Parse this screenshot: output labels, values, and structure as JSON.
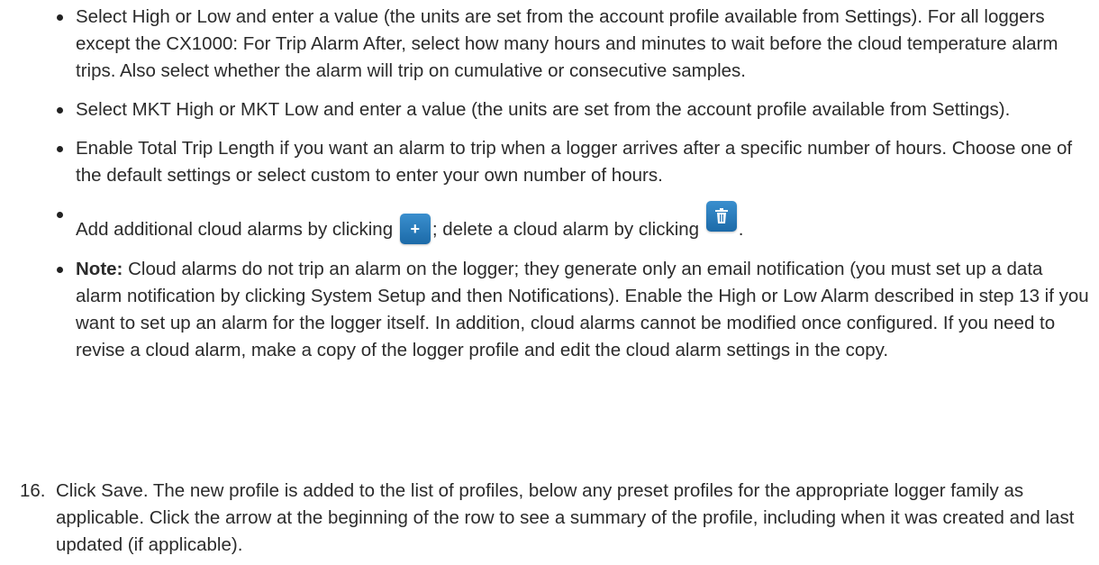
{
  "bullets": [
    "Select High or Low and enter a value (the units are set from the account profile available from Settings). For all loggers except the CX1000: For Trip Alarm After, select how many hours and minutes to wait before the cloud temperature alarm trips. Also select whether the alarm will trip on cumulative or consecutive samples.",
    "Select MKT High or MKT Low and enter a value (the units are set from the account profile available from Settings).",
    "Enable Total Trip Length if you want an alarm to trip when a logger arrives after a specific number of hours. Choose one of the default settings or select custom to enter your own number of hours."
  ],
  "alarm_buttons_line": {
    "part1": "Add additional cloud alarms by clicking",
    "add_icon": "plus-icon",
    "part2": "; delete a cloud alarm by clicking",
    "delete_icon": "trash-icon",
    "part3": ".",
    "icon_color": "#2878b8"
  },
  "note": {
    "label": "Note:",
    "text": "Cloud alarms do not trip an alarm on the logger; they generate only an email notification (you must set up a data alarm notification by clicking System Setup and then Notifications). Enable the High or Low Alarm described in step 13 if you want to set up an alarm for the logger itself. In addition, cloud alarms cannot be modified once configured. If you need to revise a cloud alarm, make a copy of the logger profile and edit the cloud alarm settings in the copy."
  },
  "step": {
    "number": "16.",
    "text": "Click Save. The new profile is added to the list of profiles, below any preset profiles for the appropriate logger family as applicable. Click the arrow at the beginning of the row to see a summary of the profile, including when it was created and last updated (if applicable)."
  }
}
